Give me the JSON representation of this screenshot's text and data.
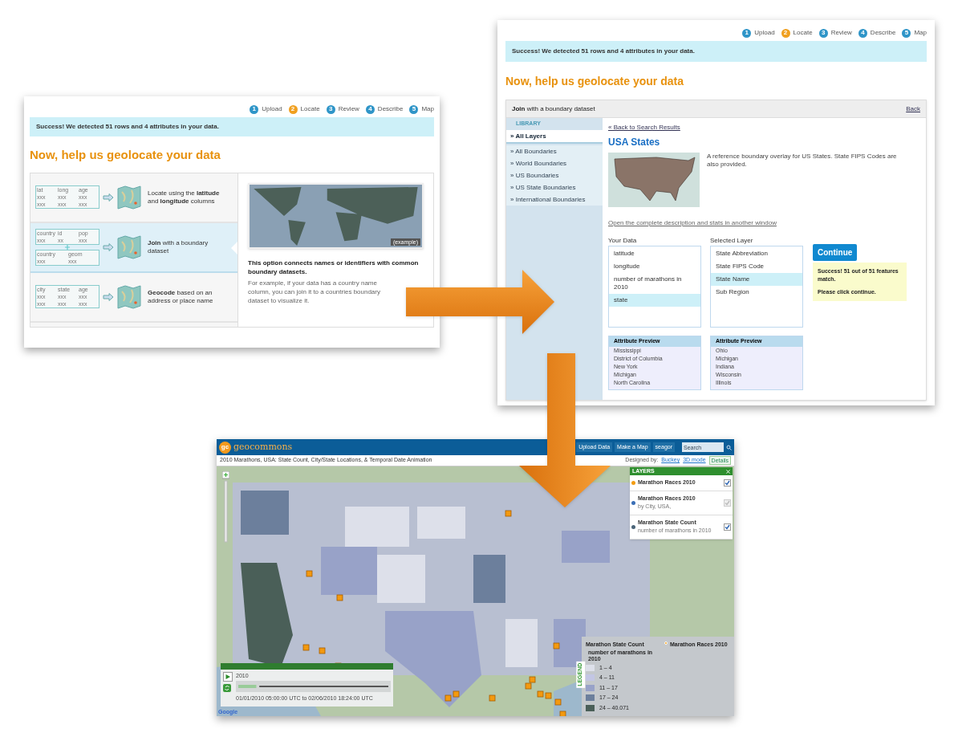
{
  "locate_screen": {
    "steps": [
      {
        "number": "1",
        "label": "Upload",
        "selected": false
      },
      {
        "number": "2",
        "label": "Locate",
        "selected": true
      },
      {
        "number": "3",
        "label": "Review",
        "selected": false
      },
      {
        "number": "4",
        "label": "Describe",
        "selected": false
      },
      {
        "number": "5",
        "label": "Map",
        "selected": false
      }
    ],
    "success_message": "Success! We detected 51 rows and 4 attributes in your data.",
    "heading": "Now, help us geolocate your data",
    "options": [
      {
        "text": "Locate using the **latitude** and **longitude** columns",
        "selected": false,
        "tables": [
          {
            "headers": [
              "lat",
              "long",
              "age"
            ],
            "rows": [
              [
                "xxx",
                "xxx",
                "xxx"
              ],
              [
                "xxx",
                "xxx",
                "xxx"
              ]
            ]
          }
        ]
      },
      {
        "text": "**Join** with a boundary dataset",
        "selected": true,
        "tables": [
          {
            "headers": [
              "country",
              "id",
              "pop"
            ],
            "rows": [
              [
                "xxx",
                "xx",
                "xxx"
              ]
            ]
          },
          {
            "headers": [
              "country",
              "geom"
            ],
            "rows": [
              [
                "xxx",
                "xxx"
              ]
            ]
          }
        ]
      },
      {
        "text": "**Geocode** based on an address or place name",
        "selected": false,
        "tables": [
          {
            "headers": [
              "city",
              "state",
              "age"
            ],
            "rows": [
              [
                "xxx",
                "xxx",
                "xxx"
              ],
              [
                "xxx",
                "xxx",
                "xxx"
              ]
            ]
          }
        ]
      }
    ],
    "example_caption": "(example)",
    "description_title": "This option connects names or identifiers with common boundary datasets.",
    "description_body": "For example, if your data has a country name column, you can join it to a countries boundary dataset to visualize it."
  },
  "join_screen": {
    "steps": [
      {
        "number": "1",
        "label": "Upload",
        "selected": false
      },
      {
        "number": "2",
        "label": "Locate",
        "selected": true
      },
      {
        "number": "3",
        "label": "Review",
        "selected": false
      },
      {
        "number": "4",
        "label": "Describe",
        "selected": false
      },
      {
        "number": "5",
        "label": "Map",
        "selected": false
      }
    ],
    "success_message": "Success! We detected 51 rows and 4 attributes in your data.",
    "heading": "Now, help us geolocate your data",
    "panel_title": "**Join** with a boundary dataset",
    "back_link": "Back",
    "library_label": "LIBRARY",
    "library_items": [
      {
        "label": "» All Layers",
        "selected": true
      },
      {
        "label": "» All Boundaries",
        "selected": false
      },
      {
        "label": "» World Boundaries",
        "selected": false
      },
      {
        "label": "» US Boundaries",
        "selected": false
      },
      {
        "label": "» US State Boundaries",
        "selected": false
      },
      {
        "label": "» International Boundaries",
        "selected": false
      }
    ],
    "back_to_results": "« Back to Search Results",
    "layer_title": "USA States",
    "layer_description": "A reference boundary overlay for US States. State FIPS Codes are also provided.",
    "open_link": "Open the complete description and stats in another window",
    "your_data": {
      "label": "Your Data",
      "items": [
        {
          "label": "latitude",
          "selected": false
        },
        {
          "label": "longitude",
          "selected": false
        },
        {
          "label": "number of marathons in 2010",
          "selected": false
        },
        {
          "label": "state",
          "selected": true
        }
      ],
      "preview": {
        "title": "Attribute Preview",
        "values": [
          "Mississippi",
          "District of Columbia",
          "New York",
          "Michigan",
          "North Carolina"
        ]
      }
    },
    "selected_layer": {
      "label": "Selected Layer",
      "items": [
        {
          "label": "State Abbreviation",
          "selected": false
        },
        {
          "label": "State FIPS Code",
          "selected": false
        },
        {
          "label": "State Name",
          "selected": true
        },
        {
          "label": "Sub Region",
          "selected": false
        }
      ],
      "preview": {
        "title": "Attribute Preview",
        "values": [
          "Ohio",
          "Michigan",
          "Indiana",
          "Wisconsin",
          "Illinois"
        ]
      }
    },
    "continue_button": "Continue",
    "match_message": "Success! 51 out of 51 features match.",
    "match_hint": "Please click continue."
  },
  "map_screen": {
    "logo_mark": "gc",
    "logo": "geocommons",
    "nav": [
      "Upload Data",
      "Make a Map",
      "seagor"
    ],
    "search_placeholder": "Search",
    "title": "2010 Marathons, USA: State Count, City/State Locations, & Temporal Date Animation",
    "designed_by": "Designed by:",
    "author_link": "Buckey",
    "mode_link": "3D mode",
    "details_button": "Details",
    "layers_title": "LAYERS",
    "layers": [
      {
        "name": "Marathon Races 2010",
        "color": "#f39c12",
        "checked": true,
        "disabled": false
      },
      {
        "name": "Marathon Races 2010",
        "subtitle": "by City, USA,",
        "color": "#3b6fb6",
        "checked": true,
        "disabled": true
      },
      {
        "name": "Marathon State Count",
        "subtitle": "number of marathons in 2010",
        "color": "#4a6478",
        "checked": true,
        "disabled": false
      }
    ],
    "legend_tab": "LEGEND",
    "legend_title": "Marathon State Count",
    "legend_subtitle": "number of marathons in 2010",
    "legend_classes": [
      {
        "label": "1 – 4",
        "color": "#dde0ea"
      },
      {
        "label": "4 – 11",
        "color": "#c3c6e4"
      },
      {
        "label": "11 – 17",
        "color": "#98a2c8"
      },
      {
        "label": "17 – 24",
        "color": "#6c7f9c"
      },
      {
        "label": "24 – 40.071",
        "color": "#4a5f58"
      }
    ],
    "point_legend": "Marathon Races 2010",
    "player_year": "2010",
    "player_range": "01/01/2010 05:00:00 UTC to 02/06/2010 18:24:00 UTC",
    "map_credit": "Google"
  }
}
